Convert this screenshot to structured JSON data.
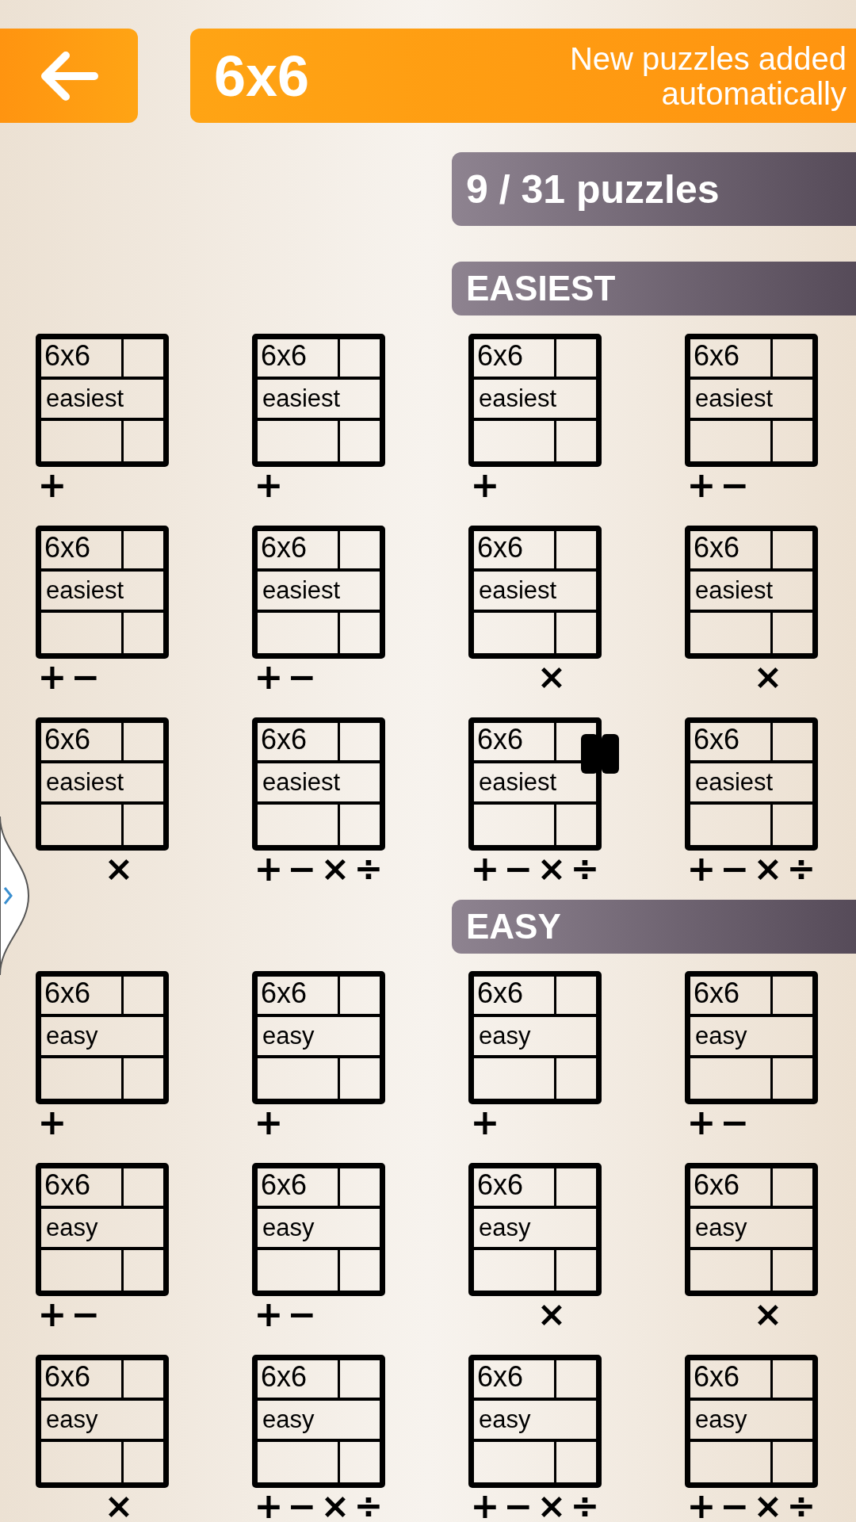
{
  "header": {
    "title": "6x6",
    "note": "New puzzles added automatically"
  },
  "progress": {
    "label": "9 / 31 puzzles"
  },
  "sections": [
    {
      "heading": "EASIEST",
      "puzzles": [
        {
          "size": "6x6",
          "level": "easiest",
          "in_progress": false,
          "operators": [
            {
              "symbol": "+",
              "kind": "add"
            }
          ]
        },
        {
          "size": "6x6",
          "level": "easiest",
          "in_progress": false,
          "operators": [
            {
              "symbol": "+",
              "kind": "add"
            }
          ]
        },
        {
          "size": "6x6",
          "level": "easiest",
          "in_progress": false,
          "operators": [
            {
              "symbol": "+",
              "kind": "add"
            }
          ]
        },
        {
          "size": "6x6",
          "level": "easiest",
          "in_progress": false,
          "operators": [
            {
              "symbol": "+",
              "kind": "add"
            },
            {
              "symbol": "−",
              "kind": "subtract"
            }
          ]
        },
        {
          "size": "6x6",
          "level": "easiest",
          "in_progress": false,
          "operators": [
            {
              "symbol": "+",
              "kind": "add"
            },
            {
              "symbol": "−",
              "kind": "subtract"
            }
          ]
        },
        {
          "size": "6x6",
          "level": "easiest",
          "in_progress": false,
          "operators": [
            {
              "symbol": "+",
              "kind": "add"
            },
            {
              "symbol": "−",
              "kind": "subtract"
            }
          ]
        },
        {
          "size": "6x6",
          "level": "easiest",
          "in_progress": false,
          "operators": [
            {
              "symbol": "×",
              "kind": "multiply"
            }
          ]
        },
        {
          "size": "6x6",
          "level": "easiest",
          "in_progress": false,
          "operators": [
            {
              "symbol": "×",
              "kind": "multiply"
            }
          ]
        },
        {
          "size": "6x6",
          "level": "easiest",
          "in_progress": false,
          "operators": [
            {
              "symbol": "×",
              "kind": "multiply"
            }
          ]
        },
        {
          "size": "6x6",
          "level": "easiest",
          "in_progress": false,
          "operators": [
            {
              "symbol": "+",
              "kind": "add"
            },
            {
              "symbol": "−",
              "kind": "subtract"
            },
            {
              "symbol": "×",
              "kind": "multiply"
            },
            {
              "symbol": "÷",
              "kind": "divide"
            }
          ]
        },
        {
          "size": "6x6",
          "level": "easiest",
          "in_progress": true,
          "operators": [
            {
              "symbol": "+",
              "kind": "add"
            },
            {
              "symbol": "−",
              "kind": "subtract"
            },
            {
              "symbol": "×",
              "kind": "multiply"
            },
            {
              "symbol": "÷",
              "kind": "divide"
            }
          ]
        },
        {
          "size": "6x6",
          "level": "easiest",
          "in_progress": false,
          "operators": [
            {
              "symbol": "+",
              "kind": "add"
            },
            {
              "symbol": "−",
              "kind": "subtract"
            },
            {
              "symbol": "×",
              "kind": "multiply"
            },
            {
              "symbol": "÷",
              "kind": "divide"
            }
          ]
        }
      ]
    },
    {
      "heading": "EASY",
      "puzzles": [
        {
          "size": "6x6",
          "level": "easy",
          "in_progress": false,
          "operators": [
            {
              "symbol": "+",
              "kind": "add"
            }
          ]
        },
        {
          "size": "6x6",
          "level": "easy",
          "in_progress": false,
          "operators": [
            {
              "symbol": "+",
              "kind": "add"
            }
          ]
        },
        {
          "size": "6x6",
          "level": "easy",
          "in_progress": false,
          "operators": [
            {
              "symbol": "+",
              "kind": "add"
            }
          ]
        },
        {
          "size": "6x6",
          "level": "easy",
          "in_progress": false,
          "operators": [
            {
              "symbol": "+",
              "kind": "add"
            },
            {
              "symbol": "−",
              "kind": "subtract"
            }
          ]
        },
        {
          "size": "6x6",
          "level": "easy",
          "in_progress": false,
          "operators": [
            {
              "symbol": "+",
              "kind": "add"
            },
            {
              "symbol": "−",
              "kind": "subtract"
            }
          ]
        },
        {
          "size": "6x6",
          "level": "easy",
          "in_progress": false,
          "operators": [
            {
              "symbol": "+",
              "kind": "add"
            },
            {
              "symbol": "−",
              "kind": "subtract"
            }
          ]
        },
        {
          "size": "6x6",
          "level": "easy",
          "in_progress": false,
          "operators": [
            {
              "symbol": "×",
              "kind": "multiply"
            }
          ]
        },
        {
          "size": "6x6",
          "level": "easy",
          "in_progress": false,
          "operators": [
            {
              "symbol": "×",
              "kind": "multiply"
            }
          ]
        },
        {
          "size": "6x6",
          "level": "easy",
          "in_progress": false,
          "operators": [
            {
              "symbol": "×",
              "kind": "multiply"
            }
          ]
        },
        {
          "size": "6x6",
          "level": "easy",
          "in_progress": false,
          "operators": [
            {
              "symbol": "+",
              "kind": "add"
            },
            {
              "symbol": "−",
              "kind": "subtract"
            },
            {
              "symbol": "×",
              "kind": "multiply"
            },
            {
              "symbol": "÷",
              "kind": "divide"
            }
          ]
        },
        {
          "size": "6x6",
          "level": "easy",
          "in_progress": false,
          "operators": [
            {
              "symbol": "+",
              "kind": "add"
            },
            {
              "symbol": "−",
              "kind": "subtract"
            },
            {
              "symbol": "×",
              "kind": "multiply"
            },
            {
              "symbol": "÷",
              "kind": "divide"
            }
          ]
        },
        {
          "size": "6x6",
          "level": "easy",
          "in_progress": false,
          "operators": [
            {
              "symbol": "+",
              "kind": "add"
            },
            {
              "symbol": "−",
              "kind": "subtract"
            },
            {
              "symbol": "×",
              "kind": "multiply"
            },
            {
              "symbol": "÷",
              "kind": "divide"
            }
          ]
        }
      ]
    }
  ]
}
